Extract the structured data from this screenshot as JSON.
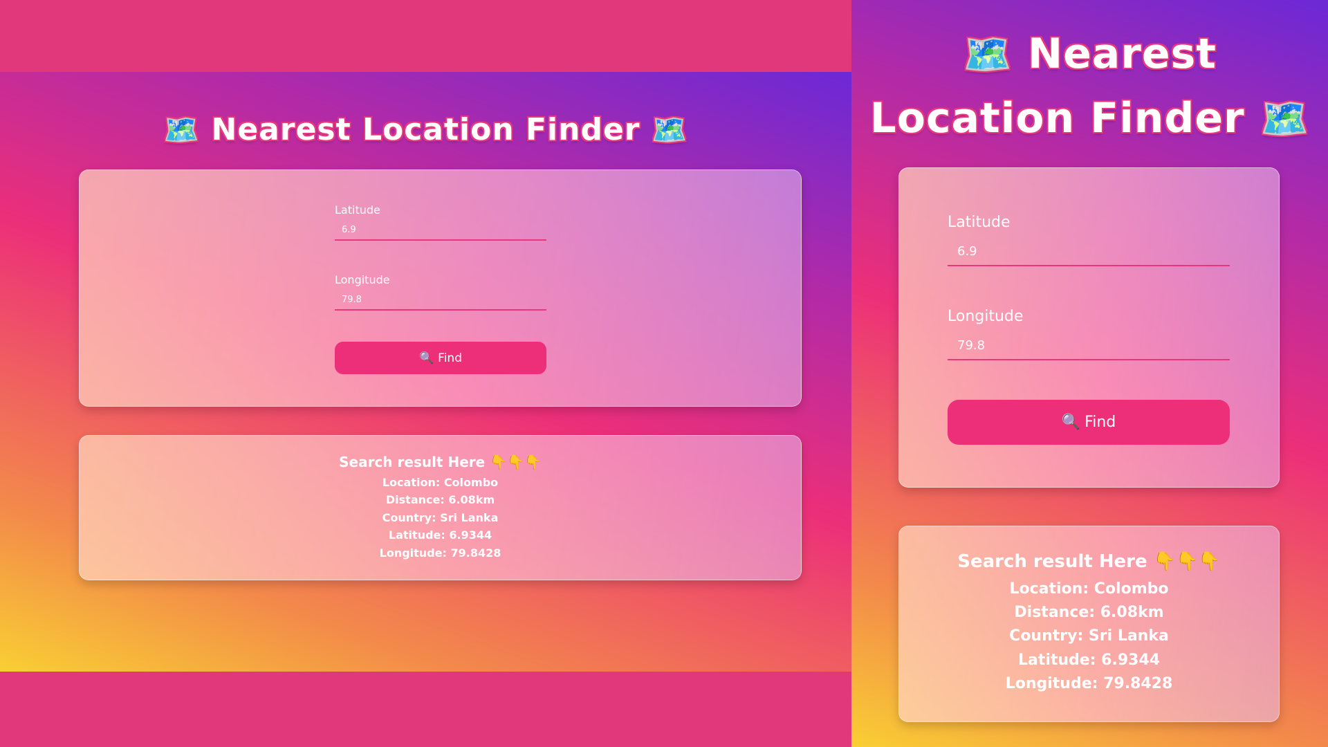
{
  "app": {
    "title_text": "Nearest Location Finder",
    "title_icon": "🗺️"
  },
  "form": {
    "latitude_label": "Latitude",
    "latitude_value": "6.9",
    "longitude_label": "Longitude",
    "longitude_value": "79.8",
    "find_icon": "🔍",
    "find_label": "Find"
  },
  "result": {
    "heading": "Search result Here 👇👇👇",
    "location": "Location: Colombo",
    "distance": "Distance: 6.08km",
    "country": "Country: Sri Lanka",
    "latitude": "Latitude: 6.9344",
    "longitude": "Longitude: 79.8428"
  },
  "colors": {
    "accent": "#ec2f78",
    "gradient_start": "#f9cf33",
    "gradient_mid": "#ec2f79",
    "gradient_end": "#6b29d6",
    "backdrop": "#e0387a"
  }
}
